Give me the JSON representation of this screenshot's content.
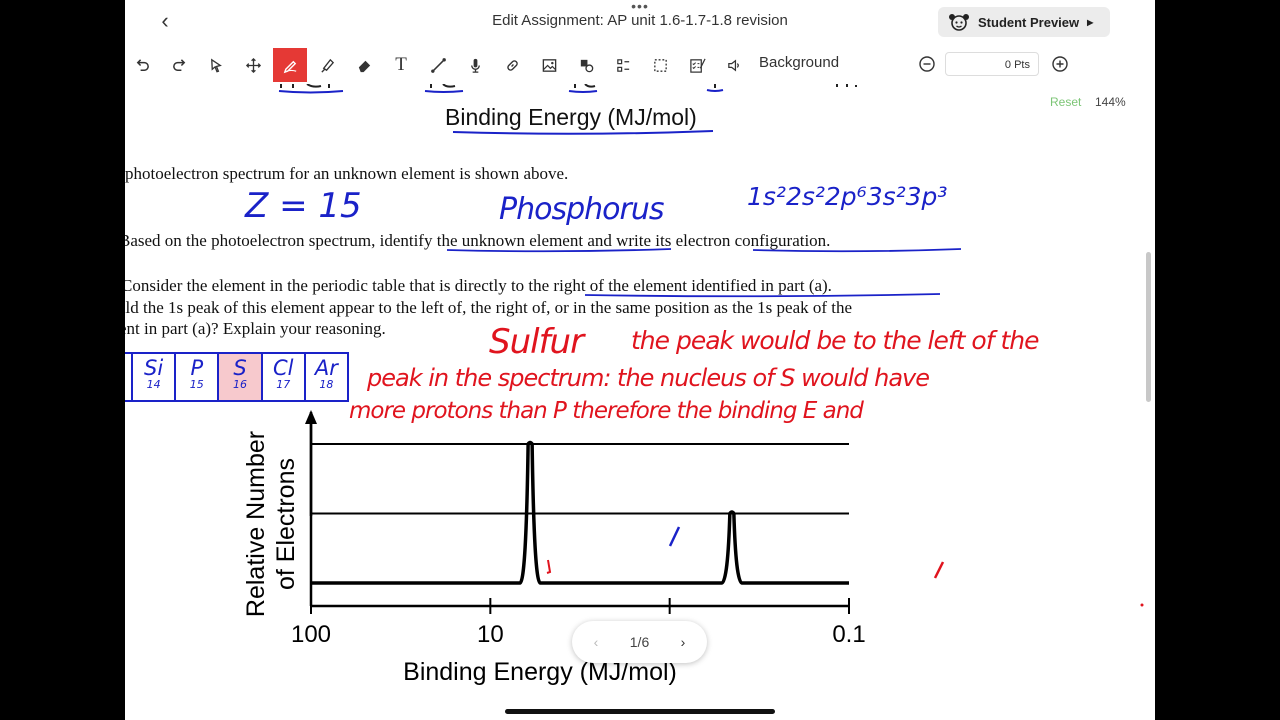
{
  "topbar": {
    "title": "Edit Assignment: AP unit 1.6-1.7-1.8 revision",
    "preview_label": "Student Preview"
  },
  "toolbar": {
    "tools": [
      "undo-icon",
      "redo-icon",
      "select-icon",
      "move-icon",
      "pen-icon",
      "marker-icon",
      "eraser-icon",
      "text-icon",
      "line-icon",
      "microphone-icon",
      "link-icon",
      "image-icon",
      "shapes-icon",
      "grid-icon",
      "checklist-icon",
      "speaker-icon"
    ],
    "active_tool": "pen-icon",
    "background_label": "Background",
    "points_value": "0 Pts"
  },
  "view": {
    "reset_label": "Reset",
    "zoom_label": "144%"
  },
  "doc": {
    "top_axis_label": "Binding Energy (MJ/mol)",
    "line1": "photoelectron spectrum for an unknown element is shown above.",
    "line2": "Based on the photoelectron spectrum, identify the unknown element and write its electron configuration.",
    "line3": "Consider the element in the periodic table that is directly to the right of the element identified in part (a).",
    "line4": "uld the 1s peak of this element appear to the left of, the right of, or in the same position as the 1s peak of the",
    "line5": "ent in part (a)? Explain your reasoning."
  },
  "handwriting": {
    "z_value": "Z = 15",
    "element": "Phosphorus",
    "configuration": "1s²2s²2p⁶3s²3p³",
    "answer_element": "Sulfur",
    "answer_line1": "the peak would be to the left of the",
    "answer_line2": "peak in the spectrum: the nucleus of S would have",
    "answer_line3": "more protons than P therefore the binding E and"
  },
  "periodic_strip": [
    {
      "symbol": "Si",
      "number": "14"
    },
    {
      "symbol": "P",
      "number": "15"
    },
    {
      "symbol": "S",
      "number": "16"
    },
    {
      "symbol": "Cl",
      "number": "17"
    },
    {
      "symbol": "Ar",
      "number": "18"
    }
  ],
  "colors": {
    "accent_red": "#e53935",
    "ink_blue": "#1a22c8",
    "ink_red": "#e0141e",
    "highlight": "#f7c9cd",
    "reset_green": "#7cc576"
  },
  "chart_data": {
    "type": "line",
    "title": "",
    "xlabel": "Binding Energy (MJ/mol)",
    "ylabel": "Relative Number of Electrons",
    "xscale": "log",
    "x_reversed": true,
    "xlim": [
      100,
      0.1
    ],
    "xticks": [
      "100",
      "10",
      "1",
      "0.1"
    ],
    "ylim": [
      0,
      2
    ],
    "gridlines_y": [
      1,
      2
    ],
    "peaks": [
      {
        "x": 6.0,
        "y": 2
      },
      {
        "x": 0.45,
        "y": 1
      }
    ]
  },
  "pager": {
    "label": "1/6"
  }
}
